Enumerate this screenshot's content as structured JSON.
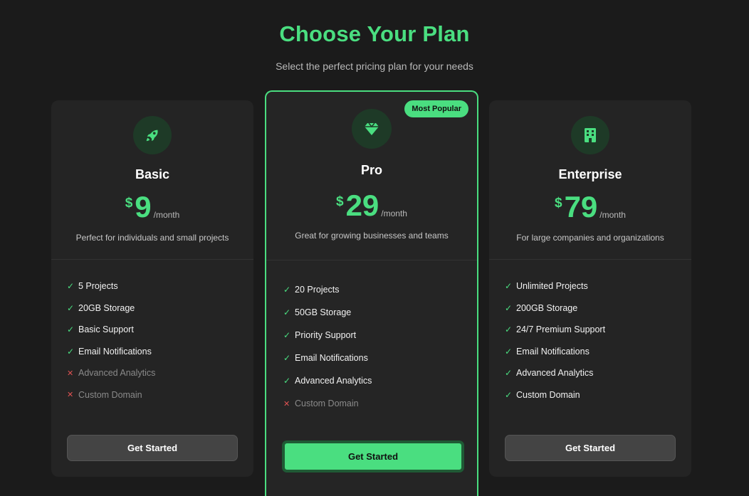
{
  "header": {
    "title": "Choose Your Plan",
    "subtitle": "Select the perfect pricing plan for your needs"
  },
  "colors": {
    "accent": "#4ade80",
    "background": "#1b1b1b",
    "card": "#242424",
    "disabled": "#e05252"
  },
  "plans": [
    {
      "name": "Basic",
      "icon": "rocket-icon",
      "currency": "$",
      "price": "9",
      "period": "/month",
      "description": "Perfect for individuals and small projects",
      "features": [
        {
          "label": "5 Projects",
          "included": true
        },
        {
          "label": "20GB Storage",
          "included": true
        },
        {
          "label": "Basic Support",
          "included": true
        },
        {
          "label": "Email Notifications",
          "included": true
        },
        {
          "label": "Advanced Analytics",
          "included": false
        },
        {
          "label": "Custom Domain",
          "included": false
        }
      ],
      "button": "Get Started"
    },
    {
      "name": "Pro",
      "icon": "gem-icon",
      "badge": "Most Popular",
      "currency": "$",
      "price": "29",
      "period": "/month",
      "description": "Great for growing businesses and teams",
      "features": [
        {
          "label": "20 Projects",
          "included": true
        },
        {
          "label": "50GB Storage",
          "included": true
        },
        {
          "label": "Priority Support",
          "included": true
        },
        {
          "label": "Email Notifications",
          "included": true
        },
        {
          "label": "Advanced Analytics",
          "included": true
        },
        {
          "label": "Custom Domain",
          "included": false
        }
      ],
      "button": "Get Started"
    },
    {
      "name": "Enterprise",
      "icon": "building-icon",
      "currency": "$",
      "price": "79",
      "period": "/month",
      "description": "For large companies and organizations",
      "features": [
        {
          "label": "Unlimited Projects",
          "included": true
        },
        {
          "label": "200GB Storage",
          "included": true
        },
        {
          "label": "24/7 Premium Support",
          "included": true
        },
        {
          "label": "Email Notifications",
          "included": true
        },
        {
          "label": "Advanced Analytics",
          "included": true
        },
        {
          "label": "Custom Domain",
          "included": true
        }
      ],
      "button": "Get Started"
    }
  ],
  "marks": {
    "check": "✓",
    "cross": "✕"
  }
}
